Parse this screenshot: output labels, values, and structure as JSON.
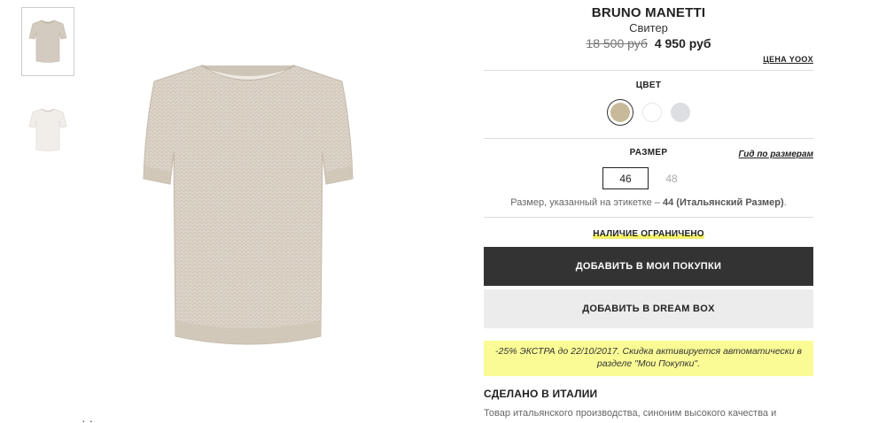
{
  "product": {
    "brand": "BRUNO MANETTI",
    "type": "Свитер",
    "old_price": "18 500 руб",
    "new_price": "4 950 руб",
    "price_source": "ЦЕНА YOOX"
  },
  "colors": {
    "title": "ЦВЕТ",
    "swatches": [
      "#c7b99a",
      "#ffffff",
      "#dcdee1"
    ]
  },
  "size": {
    "title": "РАЗМЕР",
    "guide": "Гид по размерам",
    "options": [
      "46",
      "48"
    ],
    "note_prefix": "Размер, указанный на этикетке – ",
    "note_value": "44 (Итальянский Размер)",
    "note_suffix": "."
  },
  "availability": "НАЛИЧИЕ ОГРАНИЧЕНО",
  "buttons": {
    "buy": "ДОБАВИТЬ В МОИ ПОКУПКИ",
    "dream": "ДОБАВИТЬ В DREAM BOX"
  },
  "promo": "-25% ЭКСТРА до 22/10/2017. Скидка активируется автоматически в разделе \"Мои Покупки\".",
  "origin": {
    "title": "СДЕЛАНО В ИТАЛИИ",
    "text": "Товар итальянского производства, синоним высокого качества и креативности."
  },
  "icons": {
    "thumb1": "sweater-thumbnail-beige",
    "thumb2": "sweater-thumbnail-white"
  }
}
